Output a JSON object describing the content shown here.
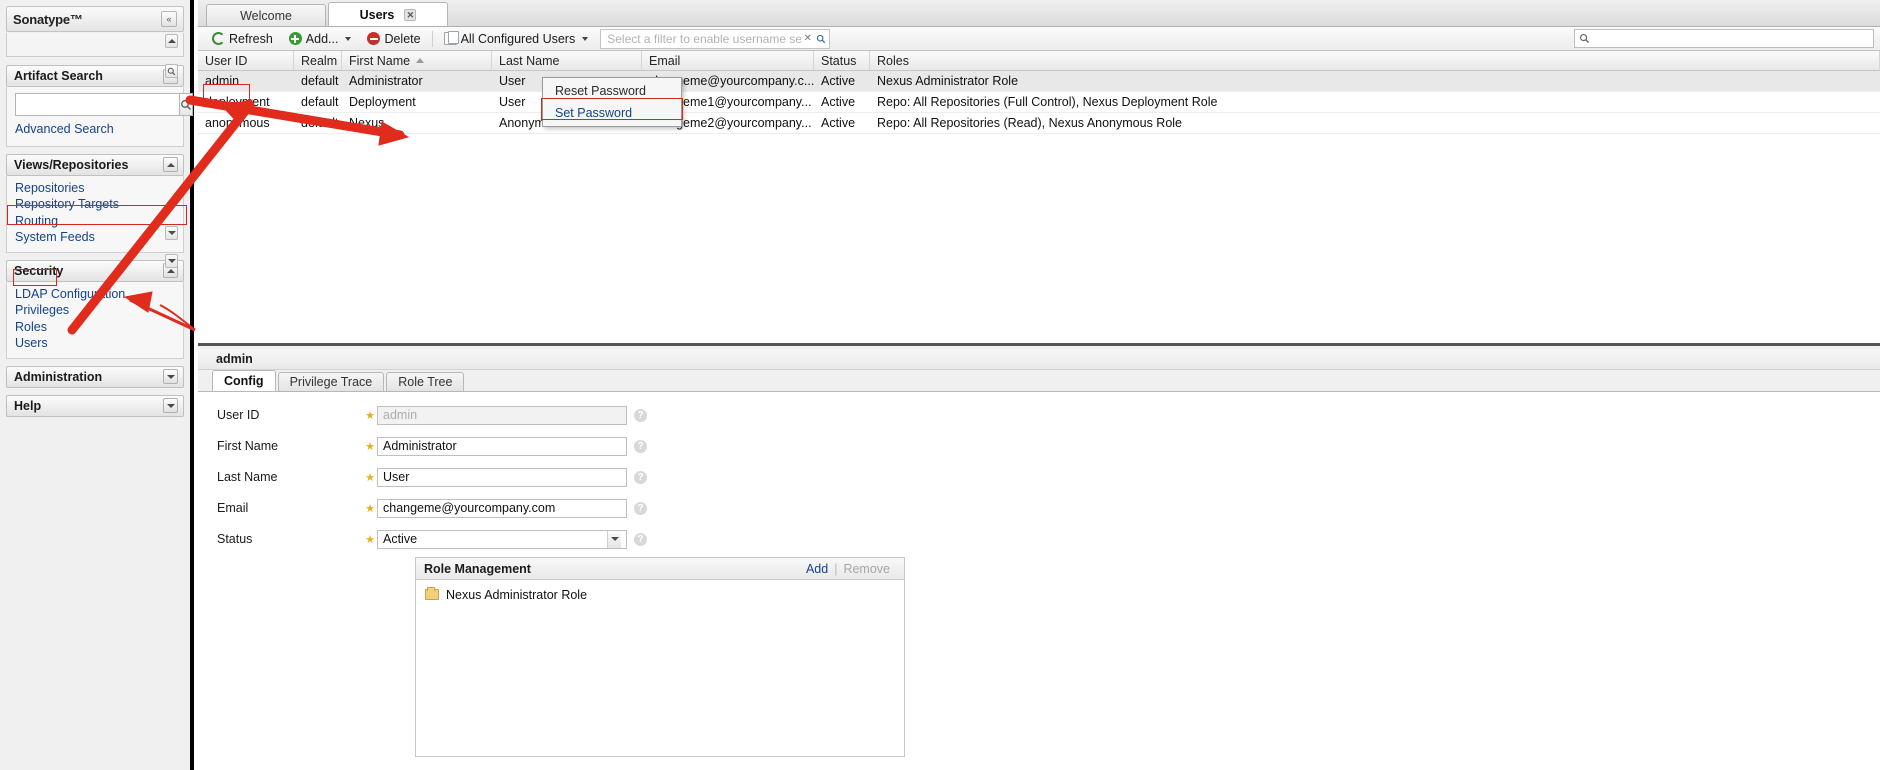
{
  "sidebar": {
    "brand": "Sonatype™",
    "collapse_icon": "double-chevron-left-icon",
    "panels": [
      {
        "title": "Artifact Search",
        "search_value": "",
        "search_placeholder": "",
        "links": [
          "Advanced Search"
        ]
      },
      {
        "title": "Views/Repositories",
        "links": [
          "Repositories",
          "Repository Targets",
          "Routing",
          "System Feeds"
        ]
      },
      {
        "title": "Security",
        "links": [
          "LDAP Configuration",
          "Privileges",
          "Roles",
          "Users"
        ]
      },
      {
        "title": "Administration",
        "links": []
      },
      {
        "title": "Help",
        "links": []
      }
    ],
    "artifact_search": {
      "title": "Artifact Search",
      "advanced_search": "Advanced Search"
    },
    "views": {
      "title": "Views/Repositories",
      "repositories": "Repositories",
      "repository_targets": "Repository Targets",
      "routing": "Routing",
      "system_feeds": "System Feeds"
    },
    "security": {
      "title": "Security",
      "ldap": "LDAP Configuration",
      "privileges": "Privileges",
      "roles": "Roles",
      "users": "Users"
    },
    "administration": {
      "title": "Administration"
    },
    "help": {
      "title": "Help"
    }
  },
  "tabs": [
    {
      "label": "Welcome",
      "active": false,
      "closable": false
    },
    {
      "label": "Users",
      "active": true,
      "closable": true,
      "close_icon": "close-icon"
    }
  ],
  "toolbar": {
    "refresh": "Refresh",
    "add": "Add...",
    "delete": "Delete",
    "filter_select": "All Configured Users",
    "filter_placeholder": "Select a filter to enable username search",
    "filter_value": "",
    "clear_icon": "clear-icon",
    "search_icon": "search-icon",
    "right_search_value": "",
    "right_search_icon": "search-icon"
  },
  "grid": {
    "columns": [
      "User ID",
      "Realm",
      "First Name",
      "Last Name",
      "Email",
      "Status",
      "Roles"
    ],
    "sort_column": "First Name",
    "sort_direction": "asc",
    "rows": [
      {
        "user_id": "admin",
        "realm": "default",
        "first_name": "Administrator",
        "last_name": "User",
        "email": "changeme@yourcompany.c...",
        "status": "Active",
        "roles": "Nexus Administrator Role",
        "selected": true
      },
      {
        "user_id": "deployment",
        "realm": "default",
        "first_name": "Deployment",
        "last_name": "User",
        "email": "changeme1@yourcompany...",
        "status": "Active",
        "roles": "Repo: All Repositories (Full Control), Nexus Deployment Role",
        "selected": false
      },
      {
        "user_id": "anonymous",
        "realm": "default",
        "first_name": "Nexus",
        "last_name": "Anonymous User",
        "email": "changeme2@yourcompany...",
        "status": "Active",
        "roles": "Repo: All Repositories (Read), Nexus Anonymous Role",
        "selected": false
      }
    ]
  },
  "context_menu": {
    "items": [
      {
        "label": "Reset Password",
        "highlighted": false
      },
      {
        "label": "Set Password",
        "highlighted": true
      }
    ]
  },
  "detail": {
    "title": "admin",
    "tabs": [
      {
        "label": "Config",
        "active": true
      },
      {
        "label": "Privilege Trace",
        "active": false
      },
      {
        "label": "Role Tree",
        "active": false
      }
    ],
    "fields": [
      {
        "label": "User ID",
        "value": "admin",
        "required": true,
        "readonly": true,
        "type": "text"
      },
      {
        "label": "First Name",
        "value": "Administrator",
        "required": true,
        "readonly": false,
        "type": "text"
      },
      {
        "label": "Last Name",
        "value": "User",
        "required": true,
        "readonly": false,
        "type": "text"
      },
      {
        "label": "Email",
        "value": "changeme@yourcompany.com",
        "required": true,
        "readonly": false,
        "type": "text"
      },
      {
        "label": "Status",
        "value": "Active",
        "required": true,
        "readonly": false,
        "type": "select"
      }
    ],
    "help_icon": "help-icon",
    "role_management": {
      "title": "Role Management",
      "add_label": "Add",
      "separator": "|",
      "remove_label": "Remove",
      "items": [
        {
          "label": "Nexus Administrator Role",
          "icon": "folder-icon"
        }
      ]
    }
  },
  "colors": {
    "accent_link": "#15428b",
    "annotation_red": "#d02a20",
    "required_star": "#e8b018",
    "add_green": "#3a9b36",
    "delete_red": "#c4312b"
  }
}
